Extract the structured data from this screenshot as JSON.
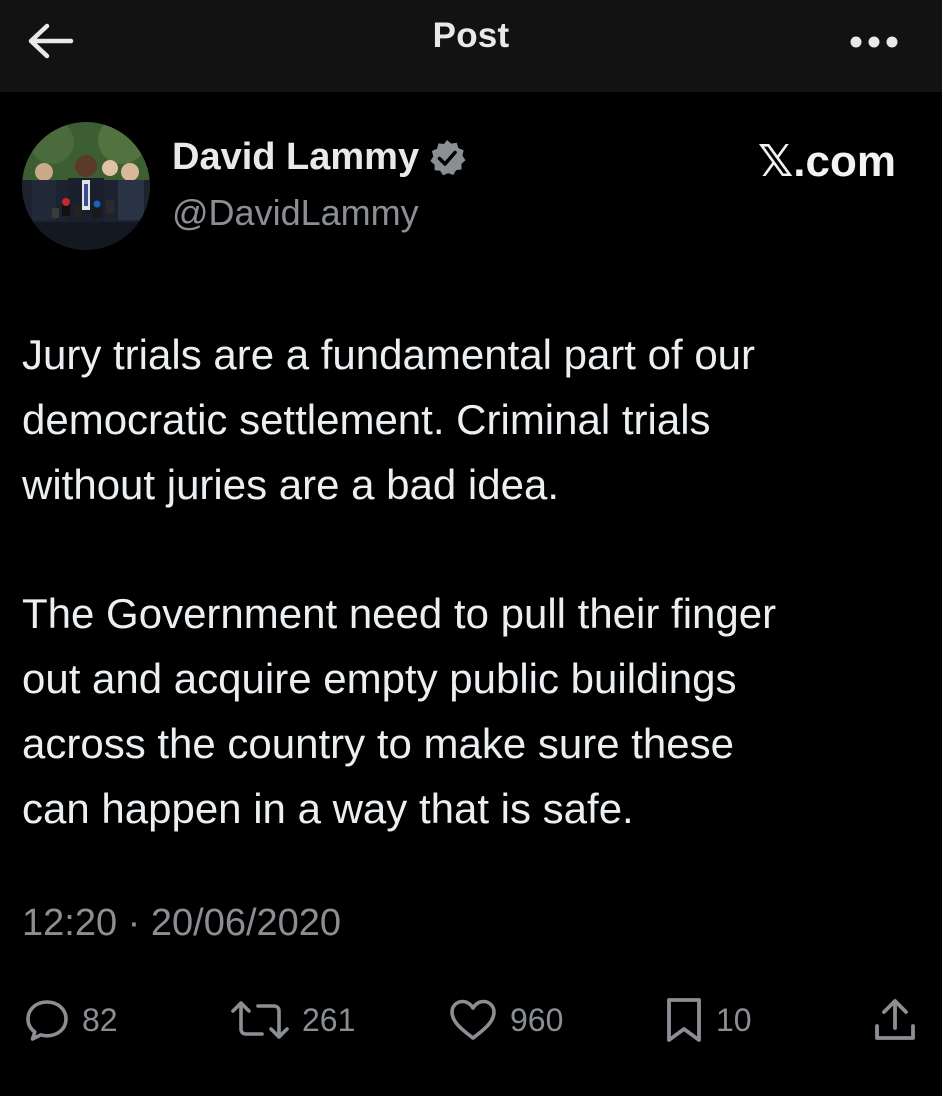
{
  "header": {
    "title": "Post",
    "back_icon": "arrow-left-icon",
    "more_icon": "more-horizontal-icon"
  },
  "author": {
    "display_name": "David Lammy",
    "handle": "@DavidLammy",
    "verified_icon": "verified-badge-icon",
    "avatar": "profile-photo"
  },
  "source": "𝕏.com",
  "post": {
    "paragraph1": [
      "Jury trials are a fundamental part of our",
      "democratic settlement. Criminal trials",
      "without juries are a bad idea."
    ],
    "paragraph2": [
      "The Government need to pull their finger",
      "out and acquire empty public buildings",
      "across the country to make sure these",
      "can happen in a way that is safe."
    ],
    "timestamp": "12:20 · 20/06/2020"
  },
  "actions": {
    "reply": {
      "icon": "reply-icon",
      "count": "82"
    },
    "repost": {
      "icon": "repost-icon",
      "count": "261"
    },
    "like": {
      "icon": "heart-icon",
      "count": "960"
    },
    "bookmark": {
      "icon": "bookmark-icon",
      "count": "10"
    },
    "share": {
      "icon": "share-icon"
    }
  },
  "colors": {
    "background": "#000000",
    "header_bg": "#121212",
    "text": "#e7e9ea",
    "muted": "#8b8f94",
    "verified": "#8b8f94"
  }
}
